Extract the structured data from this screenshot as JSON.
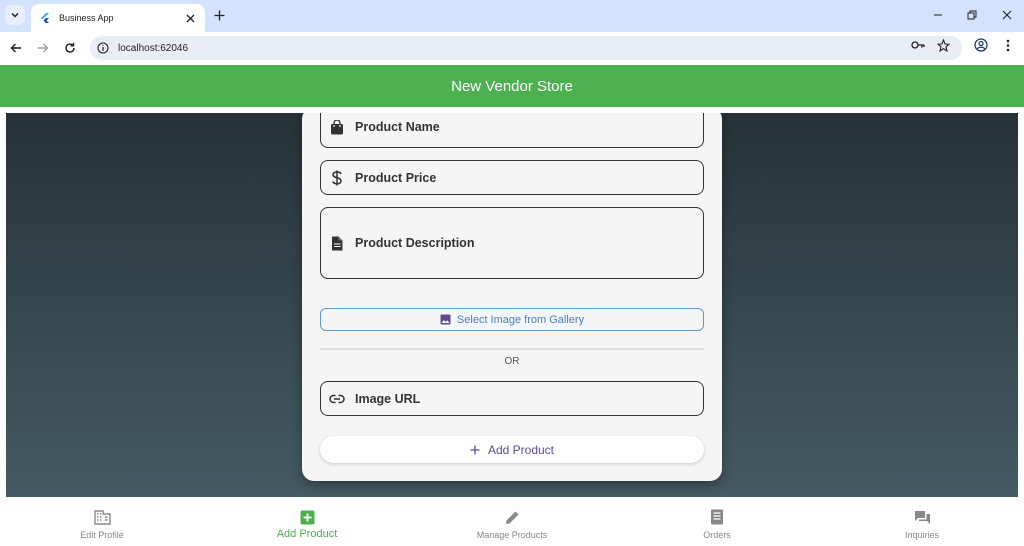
{
  "browser": {
    "tab_title": "Business App",
    "url": "localhost:62046"
  },
  "app": {
    "title": "New Vendor Store"
  },
  "form": {
    "product_name_label": "Product Name",
    "product_price_label": "Product Price",
    "product_description_label": "Product Description",
    "gallery_button_label": "Select Image from Gallery",
    "or_text": "OR",
    "image_url_label": "Image URL",
    "add_button_label": "Add Product"
  },
  "bottom_nav": {
    "items": [
      {
        "label": "Edit Profile",
        "icon": "business-icon",
        "active": false
      },
      {
        "label": "Add Product",
        "icon": "add-box-icon",
        "active": true
      },
      {
        "label": "Manage Products",
        "icon": "edit-icon",
        "active": false
      },
      {
        "label": "Orders",
        "icon": "receipt-icon",
        "active": false
      },
      {
        "label": "Inquiries",
        "icon": "forum-icon",
        "active": false
      }
    ]
  },
  "colors": {
    "primary": "#4caf50",
    "accent_purple": "#5e4a92",
    "gallery_blue": "#4a7fc1",
    "gradient_top": "#263238",
    "gradient_bottom": "#455a64"
  }
}
